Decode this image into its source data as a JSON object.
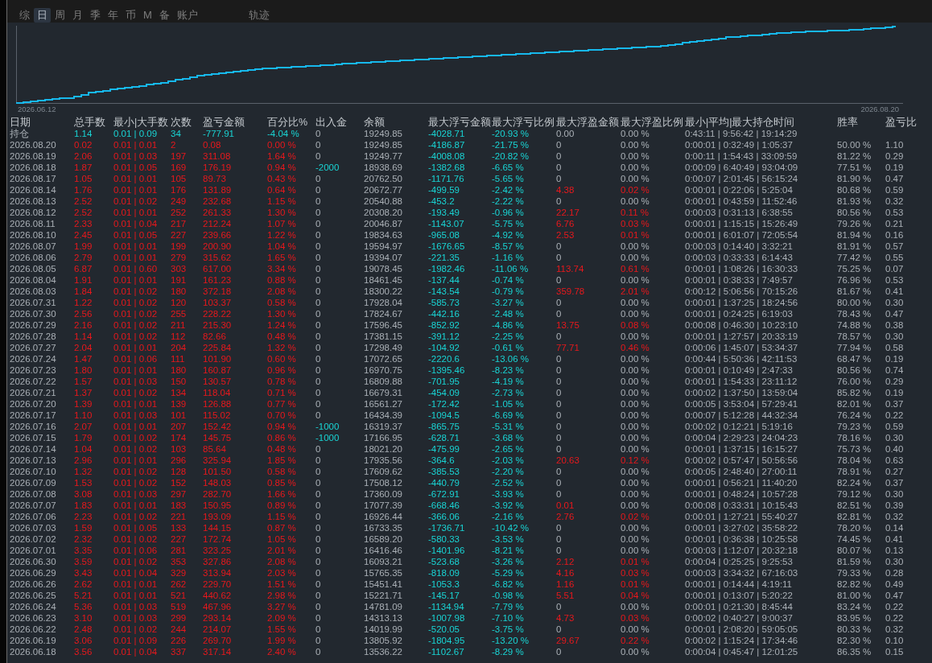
{
  "tabs": [
    {
      "label": "综",
      "selected": false
    },
    {
      "label": "日",
      "selected": true
    },
    {
      "label": "周",
      "selected": false
    },
    {
      "label": "月",
      "selected": false
    },
    {
      "label": "季",
      "selected": false
    },
    {
      "label": "年",
      "selected": false
    },
    {
      "label": "币",
      "selected": false
    },
    {
      "label": "M",
      "selected": false
    },
    {
      "label": "备",
      "selected": false
    },
    {
      "label": "账户",
      "selected": false
    }
  ],
  "side_tab": {
    "label": "轨迹",
    "selected": false
  },
  "chart": {
    "start_label": "2026.06.12",
    "end_label": "2026.08.20"
  },
  "table": {
    "columns": [
      "日期",
      "总手数",
      "最小|大手数",
      "次数",
      "盈亏金额",
      "百分比%",
      "出入金",
      "余额",
      "最大浮亏金额",
      "最大浮亏比例",
      "最大浮盈金额",
      "最大浮盈比例",
      "最小|平均|最大持仓时间",
      "胜率",
      "盈亏比"
    ],
    "summary": {
      "cells": [
        "持仓",
        "1.14",
        "0.01 | 0.09",
        "34",
        "-777.91",
        "-4.04 %",
        "0",
        "19249.85",
        "-4028.71",
        "-20.93 %",
        "0.00",
        "0.00 %",
        "0:43:11 | 9:56:42 | 19:14:29"
      ],
      "gain": false,
      "cash_moved": false,
      "float_loss": true,
      "float_gain": false,
      "float_gain_pct": false
    },
    "rows": [
      {
        "cells": [
          "2026.08.20",
          "0.02",
          "0.01 | 0.01",
          "2",
          "0.08",
          "0.00 %",
          "0",
          "19249.85",
          "-4186.87",
          "-21.75 %",
          "0",
          "0.00 %",
          "0:00:01 | 0:32:49 | 1:05:37",
          "50.00 %",
          "1.10"
        ],
        "gain": true,
        "cash_moved": false,
        "float_loss": true,
        "float_gain": false,
        "float_gain_pct": false
      },
      {
        "cells": [
          "2026.08.19",
          "2.06",
          "0.01 | 0.03",
          "197",
          "311.08",
          "1.64 %",
          "0",
          "19249.77",
          "-4008.08",
          "-20.82 %",
          "0",
          "0.00 %",
          "0:00:11 | 1:54:43 | 33:09:59",
          "81.22 %",
          "0.29"
        ],
        "gain": true,
        "cash_moved": false,
        "float_loss": true,
        "float_gain": false,
        "float_gain_pct": false
      },
      {
        "cells": [
          "2026.08.18",
          "1.87",
          "0.01 | 0.05",
          "169",
          "176.19",
          "0.94 %",
          "-2000",
          "18938.69",
          "-1382.68",
          "-6.65 %",
          "0",
          "0.00 %",
          "0:00:09 | 6:40:49 | 93:04:09",
          "77.51 %",
          "0.19"
        ],
        "gain": true,
        "cash_moved": true,
        "float_loss": true,
        "float_gain": false,
        "float_gain_pct": false
      },
      {
        "cells": [
          "2026.08.17",
          "1.05",
          "0.01 | 0.01",
          "105",
          "89.73",
          "0.43 %",
          "0",
          "20762.50",
          "-1171.76",
          "-5.65 %",
          "0",
          "0.00 %",
          "0:00:07 | 2:01:45 | 56:15:24",
          "81.90 %",
          "0.47"
        ],
        "gain": true,
        "cash_moved": false,
        "float_loss": true,
        "float_gain": false,
        "float_gain_pct": false
      },
      {
        "cells": [
          "2026.08.14",
          "1.76",
          "0.01 | 0.01",
          "176",
          "131.89",
          "0.64 %",
          "0",
          "20672.77",
          "-499.59",
          "-2.42 %",
          "4.38",
          "0.02 %",
          "0:00:01 | 0:22:06 | 5:25:04",
          "80.68 %",
          "0.59"
        ],
        "gain": true,
        "cash_moved": false,
        "float_loss": true,
        "float_gain": true,
        "float_gain_pct": true
      },
      {
        "cells": [
          "2026.08.13",
          "2.52",
          "0.01 | 0.02",
          "249",
          "232.68",
          "1.15 %",
          "0",
          "20540.88",
          "-453.2",
          "-2.22 %",
          "0",
          "0.00 %",
          "0:00:01 | 0:43:59 | 11:52:46",
          "81.93 %",
          "0.32"
        ],
        "gain": true,
        "cash_moved": false,
        "float_loss": true,
        "float_gain": false,
        "float_gain_pct": false
      },
      {
        "cells": [
          "2026.08.12",
          "2.52",
          "0.01 | 0.01",
          "252",
          "261.33",
          "1.30 %",
          "0",
          "20308.20",
          "-193.49",
          "-0.96 %",
          "22.17",
          "0.11 %",
          "0:00:03 | 0:31:13 | 6:38:55",
          "80.56 %",
          "0.53"
        ],
        "gain": true,
        "cash_moved": false,
        "float_loss": true,
        "float_gain": true,
        "float_gain_pct": true
      },
      {
        "cells": [
          "2026.08.11",
          "2.33",
          "0.01 | 0.04",
          "217",
          "212.24",
          "1.07 %",
          "0",
          "20046.87",
          "-1143.07",
          "-5.75 %",
          "6.76",
          "0.03 %",
          "0:00:01 | 1:15:15 | 15:26:49",
          "79.26 %",
          "0.21"
        ],
        "gain": true,
        "cash_moved": false,
        "float_loss": true,
        "float_gain": true,
        "float_gain_pct": true
      },
      {
        "cells": [
          "2026.08.10",
          "2.45",
          "0.01 | 0.05",
          "227",
          "239.66",
          "1.22 %",
          "0",
          "19834.63",
          "-965.08",
          "-4.92 %",
          "2.53",
          "0.01 %",
          "0:00:01 | 6:01:07 | 72:05:54",
          "81.94 %",
          "0.16"
        ],
        "gain": true,
        "cash_moved": false,
        "float_loss": true,
        "float_gain": true,
        "float_gain_pct": true
      },
      {
        "cells": [
          "2026.08.07",
          "1.99",
          "0.01 | 0.01",
          "199",
          "200.90",
          "1.04 %",
          "0",
          "19594.97",
          "-1676.65",
          "-8.57 %",
          "0",
          "0.00 %",
          "0:00:03 | 0:14:40 | 3:32:21",
          "81.91 %",
          "0.57"
        ],
        "gain": true,
        "cash_moved": false,
        "float_loss": true,
        "float_gain": false,
        "float_gain_pct": false
      },
      {
        "cells": [
          "2026.08.06",
          "2.79",
          "0.01 | 0.01",
          "279",
          "315.62",
          "1.65 %",
          "0",
          "19394.07",
          "-221.35",
          "-1.16 %",
          "0",
          "0.00 %",
          "0:00:03 | 0:33:33 | 6:14:43",
          "77.42 %",
          "0.55"
        ],
        "gain": true,
        "cash_moved": false,
        "float_loss": true,
        "float_gain": false,
        "float_gain_pct": false
      },
      {
        "cells": [
          "2026.08.05",
          "6.87",
          "0.01 | 0.60",
          "303",
          "617.00",
          "3.34 %",
          "0",
          "19078.45",
          "-1982.46",
          "-11.06 %",
          "113.74",
          "0.61 %",
          "0:00:01 | 1:08:26 | 16:30:33",
          "75.25 %",
          "0.07"
        ],
        "gain": true,
        "cash_moved": false,
        "float_loss": true,
        "float_gain": true,
        "float_gain_pct": true
      },
      {
        "cells": [
          "2026.08.04",
          "1.91",
          "0.01 | 0.01",
          "191",
          "161.23",
          "0.88 %",
          "0",
          "18461.45",
          "-137.44",
          "-0.74 %",
          "0",
          "0.00 %",
          "0:00:01 | 0:38:33 | 7:49:57",
          "76.96 %",
          "0.53"
        ],
        "gain": true,
        "cash_moved": false,
        "float_loss": true,
        "float_gain": false,
        "float_gain_pct": false
      },
      {
        "cells": [
          "2026.08.03",
          "1.84",
          "0.01 | 0.02",
          "180",
          "372.18",
          "2.08 %",
          "0",
          "18300.22",
          "-143.54",
          "-0.79 %",
          "359.78",
          "2.01 %",
          "0:00:12 | 5:06:56 | 70:15:26",
          "81.67 %",
          "0.41"
        ],
        "gain": true,
        "cash_moved": false,
        "float_loss": true,
        "float_gain": true,
        "float_gain_pct": true
      },
      {
        "cells": [
          "2026.07.31",
          "1.22",
          "0.01 | 0.02",
          "120",
          "103.37",
          "0.58 %",
          "0",
          "17928.04",
          "-585.73",
          "-3.27 %",
          "0",
          "0.00 %",
          "0:00:01 | 1:37:25 | 18:24:56",
          "80.00 %",
          "0.30"
        ],
        "gain": true,
        "cash_moved": false,
        "float_loss": true,
        "float_gain": false,
        "float_gain_pct": false
      },
      {
        "cells": [
          "2026.07.30",
          "2.56",
          "0.01 | 0.02",
          "255",
          "228.22",
          "1.30 %",
          "0",
          "17824.67",
          "-442.16",
          "-2.48 %",
          "0",
          "0.00 %",
          "0:00:01 | 0:24:25 | 6:19:03",
          "78.43 %",
          "0.47"
        ],
        "gain": true,
        "cash_moved": false,
        "float_loss": true,
        "float_gain": false,
        "float_gain_pct": false
      },
      {
        "cells": [
          "2026.07.29",
          "2.16",
          "0.01 | 0.02",
          "211",
          "215.30",
          "1.24 %",
          "0",
          "17596.45",
          "-852.92",
          "-4.86 %",
          "13.75",
          "0.08 %",
          "0:00:08 | 0:46:30 | 10:23:10",
          "74.88 %",
          "0.38"
        ],
        "gain": true,
        "cash_moved": false,
        "float_loss": true,
        "float_gain": true,
        "float_gain_pct": true
      },
      {
        "cells": [
          "2026.07.28",
          "1.14",
          "0.01 | 0.02",
          "112",
          "82.66",
          "0.48 %",
          "0",
          "17381.15",
          "-391.12",
          "-2.25 %",
          "0",
          "0.00 %",
          "0:00:01 | 1:27:57 | 20:33:19",
          "78.57 %",
          "0.30"
        ],
        "gain": true,
        "cash_moved": false,
        "float_loss": true,
        "float_gain": false,
        "float_gain_pct": false
      },
      {
        "cells": [
          "2026.07.27",
          "2.04",
          "0.01 | 0.01",
          "204",
          "225.84",
          "1.32 %",
          "0",
          "17298.49",
          "-104.92",
          "-0.61 %",
          "77.71",
          "0.46 %",
          "0:00:06 | 1:45:07 | 53:34:37",
          "77.94 %",
          "0.58"
        ],
        "gain": true,
        "cash_moved": false,
        "float_loss": true,
        "float_gain": true,
        "float_gain_pct": true
      },
      {
        "cells": [
          "2026.07.24",
          "1.47",
          "0.01 | 0.06",
          "111",
          "101.90",
          "0.60 %",
          "0",
          "17072.65",
          "-2220.6",
          "-13.06 %",
          "0",
          "0.00 %",
          "0:00:44 | 5:50:36 | 42:11:53",
          "68.47 %",
          "0.19"
        ],
        "gain": true,
        "cash_moved": false,
        "float_loss": true,
        "float_gain": false,
        "float_gain_pct": false
      },
      {
        "cells": [
          "2026.07.23",
          "1.80",
          "0.01 | 0.01",
          "180",
          "160.87",
          "0.96 %",
          "0",
          "16970.75",
          "-1395.46",
          "-8.23 %",
          "0",
          "0.00 %",
          "0:00:01 | 0:10:49 | 2:47:33",
          "80.56 %",
          "0.74"
        ],
        "gain": true,
        "cash_moved": false,
        "float_loss": true,
        "float_gain": false,
        "float_gain_pct": false
      },
      {
        "cells": [
          "2026.07.22",
          "1.57",
          "0.01 | 0.03",
          "150",
          "130.57",
          "0.78 %",
          "0",
          "16809.88",
          "-701.95",
          "-4.19 %",
          "0",
          "0.00 %",
          "0:00:01 | 1:54:33 | 23:11:12",
          "76.00 %",
          "0.29"
        ],
        "gain": true,
        "cash_moved": false,
        "float_loss": true,
        "float_gain": false,
        "float_gain_pct": false
      },
      {
        "cells": [
          "2026.07.21",
          "1.37",
          "0.01 | 0.02",
          "134",
          "118.04",
          "0.71 %",
          "0",
          "16679.31",
          "-454.09",
          "-2.73 %",
          "0",
          "0.00 %",
          "0:00:02 | 1:37:50 | 13:59:04",
          "85.82 %",
          "0.19"
        ],
        "gain": true,
        "cash_moved": false,
        "float_loss": true,
        "float_gain": false,
        "float_gain_pct": false
      },
      {
        "cells": [
          "2026.07.20",
          "1.39",
          "0.01 | 0.01",
          "139",
          "126.88",
          "0.77 %",
          "0",
          "16561.27",
          "-172.42",
          "-1.05 %",
          "0",
          "0.00 %",
          "0:00:05 | 3:53:04 | 57:29:41",
          "82.01 %",
          "0.37"
        ],
        "gain": true,
        "cash_moved": false,
        "float_loss": true,
        "float_gain": false,
        "float_gain_pct": false
      },
      {
        "cells": [
          "2026.07.17",
          "1.10",
          "0.01 | 0.03",
          "101",
          "115.02",
          "0.70 %",
          "0",
          "16434.39",
          "-1094.5",
          "-6.69 %",
          "0",
          "0.00 %",
          "0:00:07 | 5:12:28 | 44:32:34",
          "76.24 %",
          "0.22"
        ],
        "gain": true,
        "cash_moved": false,
        "float_loss": true,
        "float_gain": false,
        "float_gain_pct": false
      },
      {
        "cells": [
          "2026.07.16",
          "2.07",
          "0.01 | 0.01",
          "207",
          "152.42",
          "0.94 %",
          "-1000",
          "16319.37",
          "-865.75",
          "-5.31 %",
          "0",
          "0.00 %",
          "0:00:02 | 0:12:21 | 5:19:16",
          "79.23 %",
          "0.59"
        ],
        "gain": true,
        "cash_moved": true,
        "float_loss": true,
        "float_gain": false,
        "float_gain_pct": false
      },
      {
        "cells": [
          "2026.07.15",
          "1.79",
          "0.01 | 0.02",
          "174",
          "145.75",
          "0.86 %",
          "-1000",
          "17166.95",
          "-628.71",
          "-3.68 %",
          "0",
          "0.00 %",
          "0:00:04 | 2:29:23 | 24:04:23",
          "78.16 %",
          "0.30"
        ],
        "gain": true,
        "cash_moved": true,
        "float_loss": true,
        "float_gain": false,
        "float_gain_pct": false
      },
      {
        "cells": [
          "2026.07.14",
          "1.04",
          "0.01 | 0.02",
          "103",
          "85.64",
          "0.48 %",
          "0",
          "18021.20",
          "-475.99",
          "-2.65 %",
          "0",
          "0.00 %",
          "0:00:01 | 1:37:15 | 16:15:27",
          "75.73 %",
          "0.40"
        ],
        "gain": true,
        "cash_moved": false,
        "float_loss": true,
        "float_gain": false,
        "float_gain_pct": false
      },
      {
        "cells": [
          "2026.07.13",
          "2.96",
          "0.01 | 0.01",
          "296",
          "325.94",
          "1.85 %",
          "0",
          "17935.56",
          "-364.6",
          "-2.03 %",
          "20.63",
          "0.12 %",
          "0:00:02 | 0:57:47 | 50:56:56",
          "78.04 %",
          "0.63"
        ],
        "gain": true,
        "cash_moved": false,
        "float_loss": true,
        "float_gain": true,
        "float_gain_pct": true
      },
      {
        "cells": [
          "2026.07.10",
          "1.32",
          "0.01 | 0.02",
          "128",
          "101.50",
          "0.58 %",
          "0",
          "17609.62",
          "-385.53",
          "-2.20 %",
          "0",
          "0.00 %",
          "0:00:05 | 2:48:40 | 27:00:11",
          "78.91 %",
          "0.27"
        ],
        "gain": true,
        "cash_moved": false,
        "float_loss": true,
        "float_gain": false,
        "float_gain_pct": false
      },
      {
        "cells": [
          "2026.07.09",
          "1.53",
          "0.01 | 0.02",
          "152",
          "148.03",
          "0.85 %",
          "0",
          "17508.12",
          "-440.79",
          "-2.52 %",
          "0",
          "0.00 %",
          "0:00:01 | 0:56:21 | 11:40:20",
          "82.24 %",
          "0.37"
        ],
        "gain": true,
        "cash_moved": false,
        "float_loss": true,
        "float_gain": false,
        "float_gain_pct": false
      },
      {
        "cells": [
          "2026.07.08",
          "3.08",
          "0.01 | 0.03",
          "297",
          "282.70",
          "1.66 %",
          "0",
          "17360.09",
          "-672.91",
          "-3.93 %",
          "0",
          "0.00 %",
          "0:00:01 | 0:48:24 | 10:57:28",
          "79.12 %",
          "0.30"
        ],
        "gain": true,
        "cash_moved": false,
        "float_loss": true,
        "float_gain": false,
        "float_gain_pct": false
      },
      {
        "cells": [
          "2026.07.07",
          "1.83",
          "0.01 | 0.01",
          "183",
          "150.95",
          "0.89 %",
          "0",
          "17077.39",
          "-668.46",
          "-3.92 %",
          "0.01",
          "0.00 %",
          "0:00:08 | 0:33:31 | 10:15:43",
          "82.51 %",
          "0.39"
        ],
        "gain": true,
        "cash_moved": false,
        "float_loss": true,
        "float_gain": true,
        "float_gain_pct": false
      },
      {
        "cells": [
          "2026.07.06",
          "2.23",
          "0.01 | 0.02",
          "221",
          "193.09",
          "1.15 %",
          "0",
          "16926.44",
          "-366.06",
          "-2.16 %",
          "2.76",
          "0.02 %",
          "0:00:01 | 1:27:21 | 55:40:27",
          "82.81 %",
          "0.32"
        ],
        "gain": true,
        "cash_moved": false,
        "float_loss": true,
        "float_gain": true,
        "float_gain_pct": true
      },
      {
        "cells": [
          "2026.07.03",
          "1.59",
          "0.01 | 0.05",
          "133",
          "144.15",
          "0.87 %",
          "0",
          "16733.35",
          "-1736.71",
          "-10.42 %",
          "0",
          "0.00 %",
          "0:00:01 | 3:27:02 | 35:58:22",
          "78.20 %",
          "0.14"
        ],
        "gain": true,
        "cash_moved": false,
        "float_loss": true,
        "float_gain": false,
        "float_gain_pct": false
      },
      {
        "cells": [
          "2026.07.02",
          "2.32",
          "0.01 | 0.02",
          "227",
          "172.74",
          "1.05 %",
          "0",
          "16589.20",
          "-580.33",
          "-3.53 %",
          "0",
          "0.00 %",
          "0:00:01 | 0:36:38 | 10:25:58",
          "74.45 %",
          "0.41"
        ],
        "gain": true,
        "cash_moved": false,
        "float_loss": true,
        "float_gain": false,
        "float_gain_pct": false
      },
      {
        "cells": [
          "2026.07.01",
          "3.35",
          "0.01 | 0.06",
          "281",
          "323.25",
          "2.01 %",
          "0",
          "16416.46",
          "-1401.96",
          "-8.21 %",
          "0",
          "0.00 %",
          "0:00:03 | 1:12:07 | 20:32:18",
          "80.07 %",
          "0.13"
        ],
        "gain": true,
        "cash_moved": false,
        "float_loss": true,
        "float_gain": false,
        "float_gain_pct": false
      },
      {
        "cells": [
          "2026.06.30",
          "3.59",
          "0.01 | 0.02",
          "353",
          "327.86",
          "2.08 %",
          "0",
          "16093.21",
          "-523.68",
          "-3.26 %",
          "2.12",
          "0.01 %",
          "0:00:04 | 0:25:25 | 9:25:53",
          "81.59 %",
          "0.30"
        ],
        "gain": true,
        "cash_moved": false,
        "float_loss": true,
        "float_gain": true,
        "float_gain_pct": true
      },
      {
        "cells": [
          "2026.06.29",
          "3.43",
          "0.01 | 0.04",
          "329",
          "313.94",
          "2.03 %",
          "0",
          "15765.35",
          "-818.09",
          "-5.29 %",
          "4.16",
          "0.03 %",
          "0:00:03 | 3:34:32 | 67:16:03",
          "79.33 %",
          "0.28"
        ],
        "gain": true,
        "cash_moved": false,
        "float_loss": true,
        "float_gain": true,
        "float_gain_pct": true
      },
      {
        "cells": [
          "2026.06.26",
          "2.62",
          "0.01 | 0.01",
          "262",
          "229.70",
          "1.51 %",
          "0",
          "15451.41",
          "-1053.3",
          "-6.82 %",
          "1.16",
          "0.01 %",
          "0:00:01 | 0:14:44 | 4:19:11",
          "82.82 %",
          "0.49"
        ],
        "gain": true,
        "cash_moved": false,
        "float_loss": true,
        "float_gain": true,
        "float_gain_pct": true
      },
      {
        "cells": [
          "2026.06.25",
          "5.21",
          "0.01 | 0.01",
          "521",
          "440.62",
          "2.98 %",
          "0",
          "15221.71",
          "-145.17",
          "-0.98 %",
          "5.51",
          "0.04 %",
          "0:00:01 | 0:13:07 | 5:20:22",
          "81.00 %",
          "0.47"
        ],
        "gain": true,
        "cash_moved": false,
        "float_loss": true,
        "float_gain": true,
        "float_gain_pct": true
      },
      {
        "cells": [
          "2026.06.24",
          "5.36",
          "0.01 | 0.03",
          "519",
          "467.96",
          "3.27 %",
          "0",
          "14781.09",
          "-1134.94",
          "-7.79 %",
          "0",
          "0.00 %",
          "0:00:01 | 0:21:30 | 8:45:44",
          "83.24 %",
          "0.22"
        ],
        "gain": true,
        "cash_moved": false,
        "float_loss": true,
        "float_gain": false,
        "float_gain_pct": false
      },
      {
        "cells": [
          "2026.06.23",
          "3.10",
          "0.01 | 0.03",
          "299",
          "293.14",
          "2.09 %",
          "0",
          "14313.13",
          "-1007.98",
          "-7.10 %",
          "4.73",
          "0.03 %",
          "0:00:02 | 0:40:27 | 9:00:37",
          "83.95 %",
          "0.22"
        ],
        "gain": true,
        "cash_moved": false,
        "float_loss": true,
        "float_gain": true,
        "float_gain_pct": true
      },
      {
        "cells": [
          "2026.06.22",
          "2.48",
          "0.01 | 0.02",
          "244",
          "214.07",
          "1.55 %",
          "0",
          "14019.99",
          "-520.05",
          "-3.75 %",
          "0",
          "0.00 %",
          "0:00:01 | 2:08:20 | 59:05:05",
          "80.33 %",
          "0.32"
        ],
        "gain": true,
        "cash_moved": false,
        "float_loss": true,
        "float_gain": false,
        "float_gain_pct": false
      },
      {
        "cells": [
          "2026.06.19",
          "3.06",
          "0.01 | 0.09",
          "226",
          "269.70",
          "1.99 %",
          "0",
          "13805.92",
          "-1804.95",
          "-13.20 %",
          "29.67",
          "0.22 %",
          "0:00:02 | 1:15:24 | 17:34:46",
          "82.30 %",
          "0.10"
        ],
        "gain": true,
        "cash_moved": false,
        "float_loss": true,
        "float_gain": true,
        "float_gain_pct": true
      },
      {
        "cells": [
          "2026.06.18",
          "3.56",
          "0.01 | 0.04",
          "337",
          "317.14",
          "2.40 %",
          "0",
          "13536.22",
          "-1102.67",
          "-8.29 %",
          "0",
          "0.00 %",
          "0:00:04 | 0:45:47 | 12:01:25",
          "86.35 %",
          "0.15"
        ],
        "gain": true,
        "cash_moved": false,
        "float_loss": true,
        "float_gain": false,
        "float_gain_pct": false
      }
    ]
  }
}
